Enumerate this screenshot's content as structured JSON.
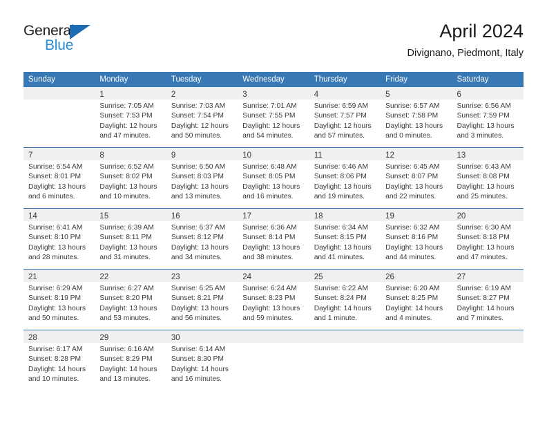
{
  "brand": {
    "name_top": "General",
    "name_bottom": "Blue",
    "accent_color": "#2b8fd4",
    "triangle_color": "#1b6cb5"
  },
  "header": {
    "title": "April 2024",
    "subtitle": "Divignano, Piedmont, Italy"
  },
  "theme": {
    "header_row_bg": "#3878b4",
    "daynum_band_bg": "#f0f0f0",
    "week_separator": "#3878b4",
    "text": "#3a3a3a"
  },
  "calendar": {
    "weekdays": [
      "Sunday",
      "Monday",
      "Tuesday",
      "Wednesday",
      "Thursday",
      "Friday",
      "Saturday"
    ],
    "weeks": [
      [
        {
          "day": ""
        },
        {
          "day": "1",
          "sunrise": "Sunrise: 7:05 AM",
          "sunset": "Sunset: 7:53 PM",
          "daylight_line1": "Daylight: 12 hours",
          "daylight_line2": "and 47 minutes."
        },
        {
          "day": "2",
          "sunrise": "Sunrise: 7:03 AM",
          "sunset": "Sunset: 7:54 PM",
          "daylight_line1": "Daylight: 12 hours",
          "daylight_line2": "and 50 minutes."
        },
        {
          "day": "3",
          "sunrise": "Sunrise: 7:01 AM",
          "sunset": "Sunset: 7:55 PM",
          "daylight_line1": "Daylight: 12 hours",
          "daylight_line2": "and 54 minutes."
        },
        {
          "day": "4",
          "sunrise": "Sunrise: 6:59 AM",
          "sunset": "Sunset: 7:57 PM",
          "daylight_line1": "Daylight: 12 hours",
          "daylight_line2": "and 57 minutes."
        },
        {
          "day": "5",
          "sunrise": "Sunrise: 6:57 AM",
          "sunset": "Sunset: 7:58 PM",
          "daylight_line1": "Daylight: 13 hours",
          "daylight_line2": "and 0 minutes."
        },
        {
          "day": "6",
          "sunrise": "Sunrise: 6:56 AM",
          "sunset": "Sunset: 7:59 PM",
          "daylight_line1": "Daylight: 13 hours",
          "daylight_line2": "and 3 minutes."
        }
      ],
      [
        {
          "day": "7",
          "sunrise": "Sunrise: 6:54 AM",
          "sunset": "Sunset: 8:01 PM",
          "daylight_line1": "Daylight: 13 hours",
          "daylight_line2": "and 6 minutes."
        },
        {
          "day": "8",
          "sunrise": "Sunrise: 6:52 AM",
          "sunset": "Sunset: 8:02 PM",
          "daylight_line1": "Daylight: 13 hours",
          "daylight_line2": "and 10 minutes."
        },
        {
          "day": "9",
          "sunrise": "Sunrise: 6:50 AM",
          "sunset": "Sunset: 8:03 PM",
          "daylight_line1": "Daylight: 13 hours",
          "daylight_line2": "and 13 minutes."
        },
        {
          "day": "10",
          "sunrise": "Sunrise: 6:48 AM",
          "sunset": "Sunset: 8:05 PM",
          "daylight_line1": "Daylight: 13 hours",
          "daylight_line2": "and 16 minutes."
        },
        {
          "day": "11",
          "sunrise": "Sunrise: 6:46 AM",
          "sunset": "Sunset: 8:06 PM",
          "daylight_line1": "Daylight: 13 hours",
          "daylight_line2": "and 19 minutes."
        },
        {
          "day": "12",
          "sunrise": "Sunrise: 6:45 AM",
          "sunset": "Sunset: 8:07 PM",
          "daylight_line1": "Daylight: 13 hours",
          "daylight_line2": "and 22 minutes."
        },
        {
          "day": "13",
          "sunrise": "Sunrise: 6:43 AM",
          "sunset": "Sunset: 8:08 PM",
          "daylight_line1": "Daylight: 13 hours",
          "daylight_line2": "and 25 minutes."
        }
      ],
      [
        {
          "day": "14",
          "sunrise": "Sunrise: 6:41 AM",
          "sunset": "Sunset: 8:10 PM",
          "daylight_line1": "Daylight: 13 hours",
          "daylight_line2": "and 28 minutes."
        },
        {
          "day": "15",
          "sunrise": "Sunrise: 6:39 AM",
          "sunset": "Sunset: 8:11 PM",
          "daylight_line1": "Daylight: 13 hours",
          "daylight_line2": "and 31 minutes."
        },
        {
          "day": "16",
          "sunrise": "Sunrise: 6:37 AM",
          "sunset": "Sunset: 8:12 PM",
          "daylight_line1": "Daylight: 13 hours",
          "daylight_line2": "and 34 minutes."
        },
        {
          "day": "17",
          "sunrise": "Sunrise: 6:36 AM",
          "sunset": "Sunset: 8:14 PM",
          "daylight_line1": "Daylight: 13 hours",
          "daylight_line2": "and 38 minutes."
        },
        {
          "day": "18",
          "sunrise": "Sunrise: 6:34 AM",
          "sunset": "Sunset: 8:15 PM",
          "daylight_line1": "Daylight: 13 hours",
          "daylight_line2": "and 41 minutes."
        },
        {
          "day": "19",
          "sunrise": "Sunrise: 6:32 AM",
          "sunset": "Sunset: 8:16 PM",
          "daylight_line1": "Daylight: 13 hours",
          "daylight_line2": "and 44 minutes."
        },
        {
          "day": "20",
          "sunrise": "Sunrise: 6:30 AM",
          "sunset": "Sunset: 8:18 PM",
          "daylight_line1": "Daylight: 13 hours",
          "daylight_line2": "and 47 minutes."
        }
      ],
      [
        {
          "day": "21",
          "sunrise": "Sunrise: 6:29 AM",
          "sunset": "Sunset: 8:19 PM",
          "daylight_line1": "Daylight: 13 hours",
          "daylight_line2": "and 50 minutes."
        },
        {
          "day": "22",
          "sunrise": "Sunrise: 6:27 AM",
          "sunset": "Sunset: 8:20 PM",
          "daylight_line1": "Daylight: 13 hours",
          "daylight_line2": "and 53 minutes."
        },
        {
          "day": "23",
          "sunrise": "Sunrise: 6:25 AM",
          "sunset": "Sunset: 8:21 PM",
          "daylight_line1": "Daylight: 13 hours",
          "daylight_line2": "and 56 minutes."
        },
        {
          "day": "24",
          "sunrise": "Sunrise: 6:24 AM",
          "sunset": "Sunset: 8:23 PM",
          "daylight_line1": "Daylight: 13 hours",
          "daylight_line2": "and 59 minutes."
        },
        {
          "day": "25",
          "sunrise": "Sunrise: 6:22 AM",
          "sunset": "Sunset: 8:24 PM",
          "daylight_line1": "Daylight: 14 hours",
          "daylight_line2": "and 1 minute."
        },
        {
          "day": "26",
          "sunrise": "Sunrise: 6:20 AM",
          "sunset": "Sunset: 8:25 PM",
          "daylight_line1": "Daylight: 14 hours",
          "daylight_line2": "and 4 minutes."
        },
        {
          "day": "27",
          "sunrise": "Sunrise: 6:19 AM",
          "sunset": "Sunset: 8:27 PM",
          "daylight_line1": "Daylight: 14 hours",
          "daylight_line2": "and 7 minutes."
        }
      ],
      [
        {
          "day": "28",
          "sunrise": "Sunrise: 6:17 AM",
          "sunset": "Sunset: 8:28 PM",
          "daylight_line1": "Daylight: 14 hours",
          "daylight_line2": "and 10 minutes."
        },
        {
          "day": "29",
          "sunrise": "Sunrise: 6:16 AM",
          "sunset": "Sunset: 8:29 PM",
          "daylight_line1": "Daylight: 14 hours",
          "daylight_line2": "and 13 minutes."
        },
        {
          "day": "30",
          "sunrise": "Sunrise: 6:14 AM",
          "sunset": "Sunset: 8:30 PM",
          "daylight_line1": "Daylight: 14 hours",
          "daylight_line2": "and 16 minutes."
        },
        {
          "day": ""
        },
        {
          "day": ""
        },
        {
          "day": ""
        },
        {
          "day": ""
        }
      ]
    ]
  }
}
